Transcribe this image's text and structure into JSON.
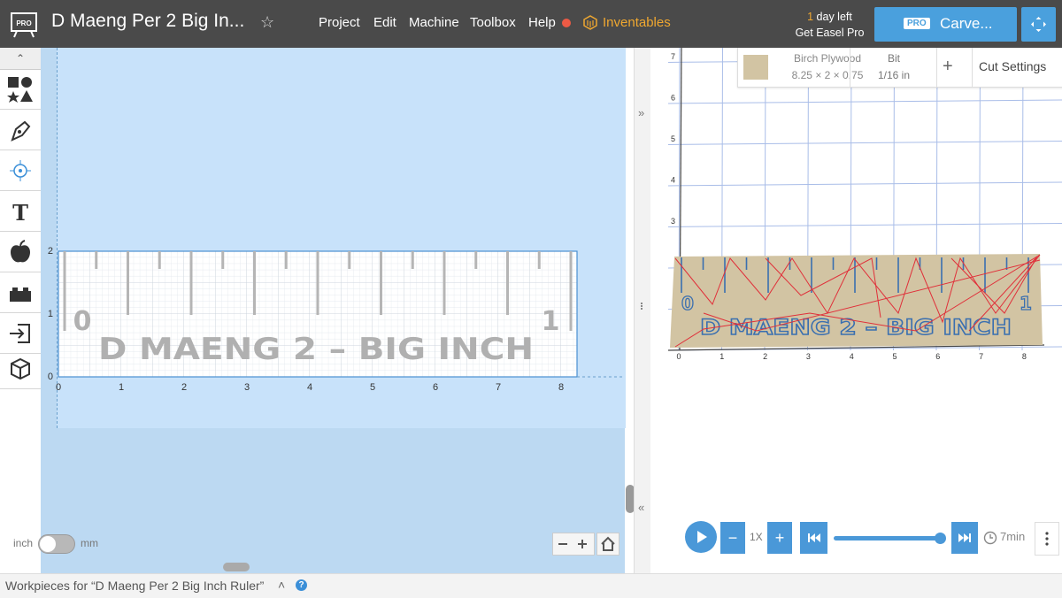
{
  "header": {
    "logo_text": "PRO",
    "title": "D Maeng Per 2 Big In...",
    "menu": [
      "Project",
      "Edit",
      "Machine",
      "Toolbox",
      "Help"
    ],
    "inventables": "Inventables",
    "trial_count": "1",
    "trial_suffix": " day left",
    "get_pro": "Get Easel Pro",
    "carve_badge": "PRO",
    "carve_label": "Carve..."
  },
  "toolbar": {
    "collapse": "«"
  },
  "design": {
    "text": "D MAENG  2 – BIG INCH",
    "ruler_left": "0",
    "ruler_right": "1",
    "x_ticks": [
      "0",
      "1",
      "2",
      "3",
      "4",
      "5",
      "6",
      "7",
      "8"
    ],
    "y_ticks": [
      "0",
      "1",
      "2"
    ],
    "unit_inch": "inch",
    "unit_mm": "mm"
  },
  "preview": {
    "material_name": "Birch Plywood",
    "material_size": "8.25 × 2 × 0.75",
    "bit_label": "Bit",
    "bit_value": "1/16 in",
    "add": "+",
    "cut_settings": "Cut Settings",
    "x_ticks": [
      "0",
      "1",
      "2",
      "3",
      "4",
      "5",
      "6",
      "7",
      "8"
    ],
    "y_ticks": [
      "3",
      "4",
      "5",
      "6",
      "7"
    ],
    "engrave_text": "D MAENG  2 – BIG INCH",
    "ruler_left": "0",
    "ruler_right": "1"
  },
  "playback": {
    "minus": "−",
    "speed": "1X",
    "plus": "+",
    "time": "7min"
  },
  "divider": {
    "expand": "»",
    "collapse": "«"
  },
  "footer": {
    "text": "Workpieces for “D Maeng Per 2 Big Inch Ruler”",
    "chevron": "˄",
    "help": "?"
  },
  "colors": {
    "accent": "#4a98d8",
    "brand_orange": "#f0a830",
    "toolpath_red": "#e0303a",
    "plywood": "#d2c4a3"
  }
}
